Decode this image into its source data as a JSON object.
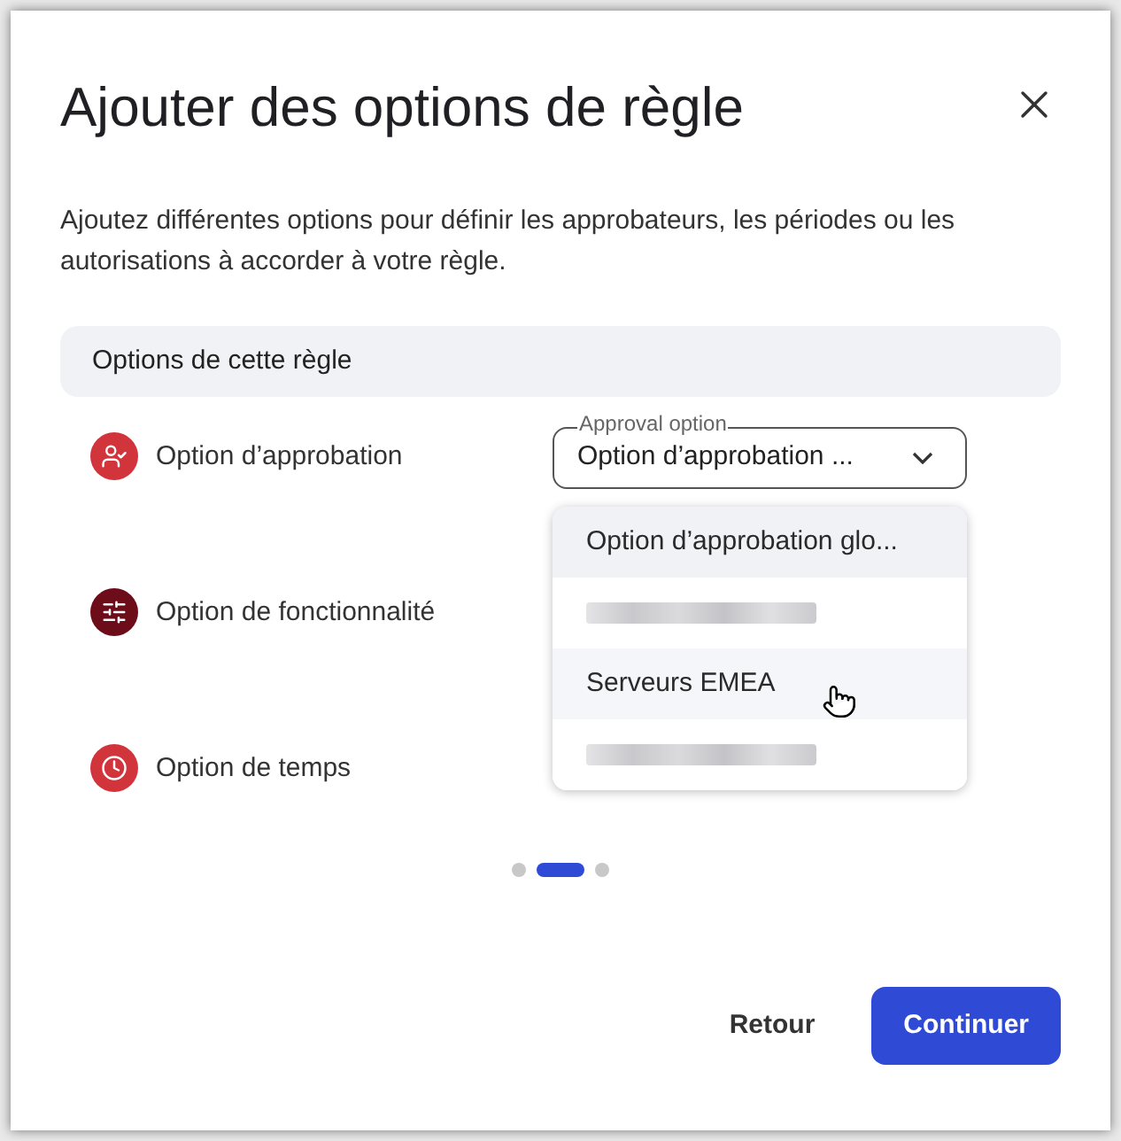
{
  "dialog": {
    "title": "Ajouter des options de règle",
    "description": "Ajoutez différentes options pour définir les approbateurs, les périodes ou les autorisations à accorder à votre règle."
  },
  "section": {
    "title": "Options de cette règle"
  },
  "options": [
    {
      "kind": "approval",
      "label": "Option d’approbation",
      "color": "#d2343c"
    },
    {
      "kind": "feature",
      "label": "Option de fonctionnalité",
      "color": "#6e0d1a"
    },
    {
      "kind": "time",
      "label": "Option de temps",
      "color": "#d2343c"
    }
  ],
  "select": {
    "label": "Approval option",
    "value": "Option d’approbation ...",
    "expanded": true
  },
  "menu": [
    {
      "kind": "text",
      "label": "Option d’approbation glo...",
      "selected": true,
      "hovered": false
    },
    {
      "kind": "redacted",
      "selected": false,
      "hovered": false
    },
    {
      "kind": "text",
      "label": "Serveurs EMEA",
      "selected": false,
      "hovered": true
    },
    {
      "kind": "redacted",
      "selected": false,
      "hovered": false
    }
  ],
  "pager": [
    {
      "selected": false
    },
    {
      "selected": true
    },
    {
      "selected": false
    }
  ],
  "buttons": {
    "back": "Retour",
    "continue": "Continuer"
  }
}
